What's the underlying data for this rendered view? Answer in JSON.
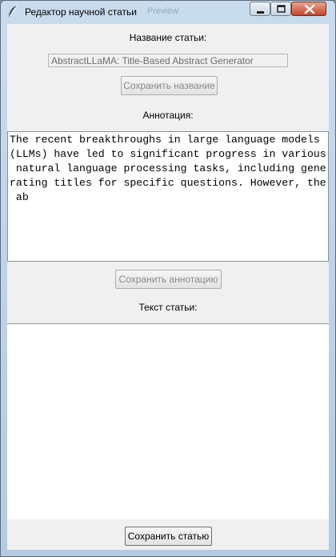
{
  "window": {
    "title": "Редактор научной статьи",
    "ghost_title": "Preview"
  },
  "title_section": {
    "label": "Название статьи:",
    "value": "AbstractLLaMA: Title-Based Abstract Generator",
    "save_button": "Сохранить название"
  },
  "abstract_section": {
    "label": "Аннотация:",
    "lines": [
      "The recent breakthroughs in large language models",
      "(LLMs) have led to significant progress in various",
      " natural language processing tasks, including gene",
      "rating titles for specific questions. However, the",
      " ab"
    ],
    "save_button": "Сохранить аннотацию"
  },
  "article_section": {
    "label": "Текст статьи:",
    "content": "",
    "save_button": "Сохранить статью"
  }
}
